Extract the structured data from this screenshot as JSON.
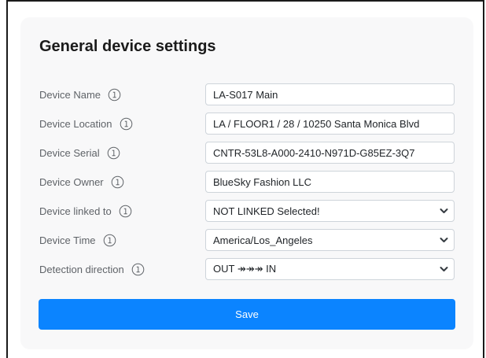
{
  "card": {
    "title": "General device settings"
  },
  "fields": {
    "device_name": {
      "label": "Device Name",
      "value": "LA-S017 Main"
    },
    "device_location": {
      "label": "Device Location",
      "value": "LA / FLOOR1 / 28 / 10250 Santa Monica Blvd"
    },
    "device_serial": {
      "label": "Device Serial",
      "value": "CNTR-53L8-A000-2410-N971D-G85EZ-3Q7"
    },
    "device_owner": {
      "label": "Device Owner",
      "value": "BlueSky Fashion LLC"
    },
    "device_linked_to": {
      "label": "Device linked to",
      "selected": "NOT LINKED Selected!"
    },
    "device_time": {
      "label": "Device Time",
      "selected": "America/Los_Angeles"
    },
    "detection_direction": {
      "label": "Detection direction",
      "selected": "OUT ↠↠↠ IN"
    }
  },
  "actions": {
    "save_label": "Save"
  },
  "icons": {
    "info": "info-icon",
    "dropdown": "chevron-down-icon"
  },
  "colors": {
    "primary_button": "#0b84ff",
    "card_background": "#f8f8f9",
    "label_text": "#5f6368"
  }
}
